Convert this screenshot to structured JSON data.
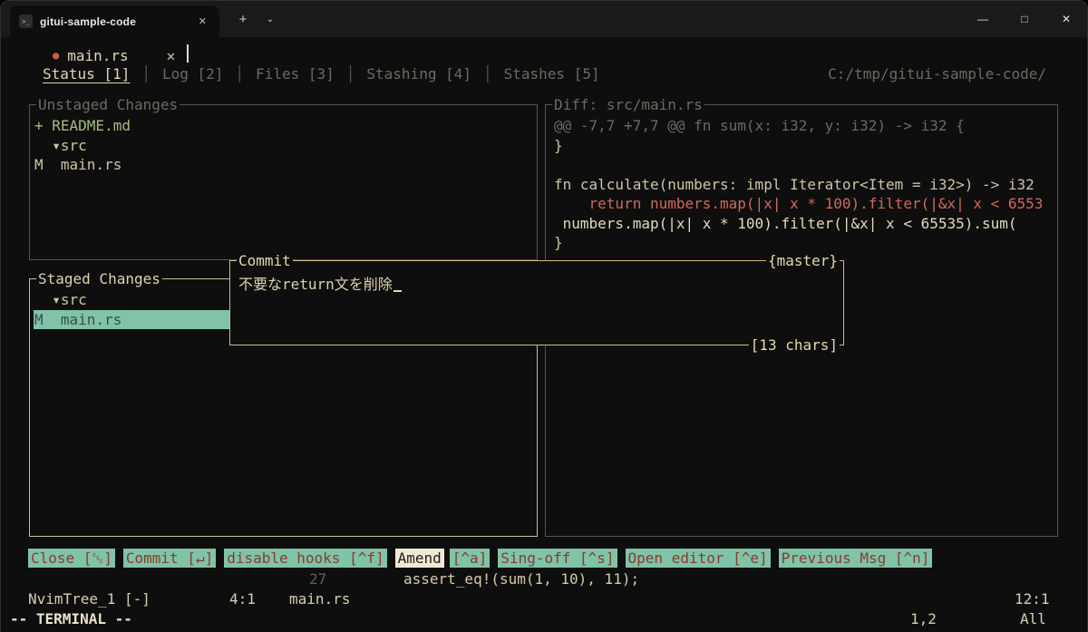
{
  "titlebar": {
    "tab_icon": ">_",
    "tab_title": "gitui-sample-code",
    "tab_close": "✕",
    "new_tab_button": "+",
    "dropdown_button": "⌄",
    "minimize_button": "—",
    "maximize_button": "□",
    "close_button": "✕"
  },
  "bufferline": {
    "modified_dot": "●",
    "buffer_name": "main.rs",
    "close_icon": "✕"
  },
  "gitui": {
    "tab_bar": {
      "tabs": [
        "Status [1]",
        "Log [2]",
        "Files [3]",
        "Stashing [4]",
        "Stashes [5]"
      ],
      "active_tab": "Status [1]",
      "separator": "│",
      "repo_path": "C:/tmp/gitui-sample-code/"
    },
    "unstaged_panel": {
      "title": "Unstaged Changes",
      "items": [
        {
          "text": "+ README.md",
          "status": "new"
        },
        {
          "text": "  ▾src",
          "status": "directory"
        },
        {
          "text": "M  main.rs",
          "status": "modified"
        }
      ]
    },
    "staged_panel": {
      "title": "Staged Changes",
      "items": [
        {
          "text": "  ▾src",
          "status": "directory"
        },
        {
          "text": "M  main.rs",
          "status": "modified",
          "selected": true
        }
      ]
    },
    "diff_panel": {
      "title": "Diff: src/main.rs",
      "lines": [
        {
          "text": "@@ -7,7 +7,7 @@ fn sum(x: i32, y: i32) -> i32 {",
          "kind": "hunk"
        },
        {
          "text": "}",
          "kind": "context"
        },
        {
          "text": " ",
          "kind": "context"
        },
        {
          "text": "fn calculate(numbers: impl Iterator<Item = i32>) -> i32",
          "kind": "context"
        },
        {
          "text": "    return numbers.map(|x| x * 100).filter(|&x| x < 6553",
          "kind": "removed"
        },
        {
          "text": " numbers.map(|x| x * 100).filter(|&x| x < 65535).sum(",
          "kind": "added"
        },
        {
          "text": "}",
          "kind": "context"
        }
      ]
    },
    "commit_popup": {
      "title": "Commit",
      "branch_badge": "{master}",
      "message": "不要なreturn文を削除",
      "char_count": "[13 chars]"
    },
    "command_bar": [
      {
        "label": "Close [␛]"
      },
      {
        "label": "Commit [↵]"
      },
      {
        "label": "disable hooks [^f]"
      },
      {
        "label": "Amend",
        "key": "[^a]"
      },
      {
        "label": "Sing-off [^s]"
      },
      {
        "label": "Open editor [^e]"
      },
      {
        "label": "Previous Msg [^n]"
      }
    ]
  },
  "editor": {
    "line_number": "27",
    "code_line": "assert_eq!(sum(1, 10), 11);",
    "statusline": {
      "buffer": "NvimTree_1 [-]",
      "position": "4:1",
      "filename": "main.rs",
      "right_position": "12:1"
    },
    "modeline": {
      "mode": "-- TERMINAL --",
      "cursor": "1,2",
      "scroll": "All"
    }
  },
  "colors": {
    "terminal_background": "#0e0e0e",
    "foreground_cream": "#cfc4a4",
    "teal_accent": "#7fc3a8",
    "diff_removed_red": "#d0695c",
    "added_file_green": "#a3bd7e",
    "popup_border_gold": "#d4ba80",
    "dim_gray": "#6b6b60"
  }
}
